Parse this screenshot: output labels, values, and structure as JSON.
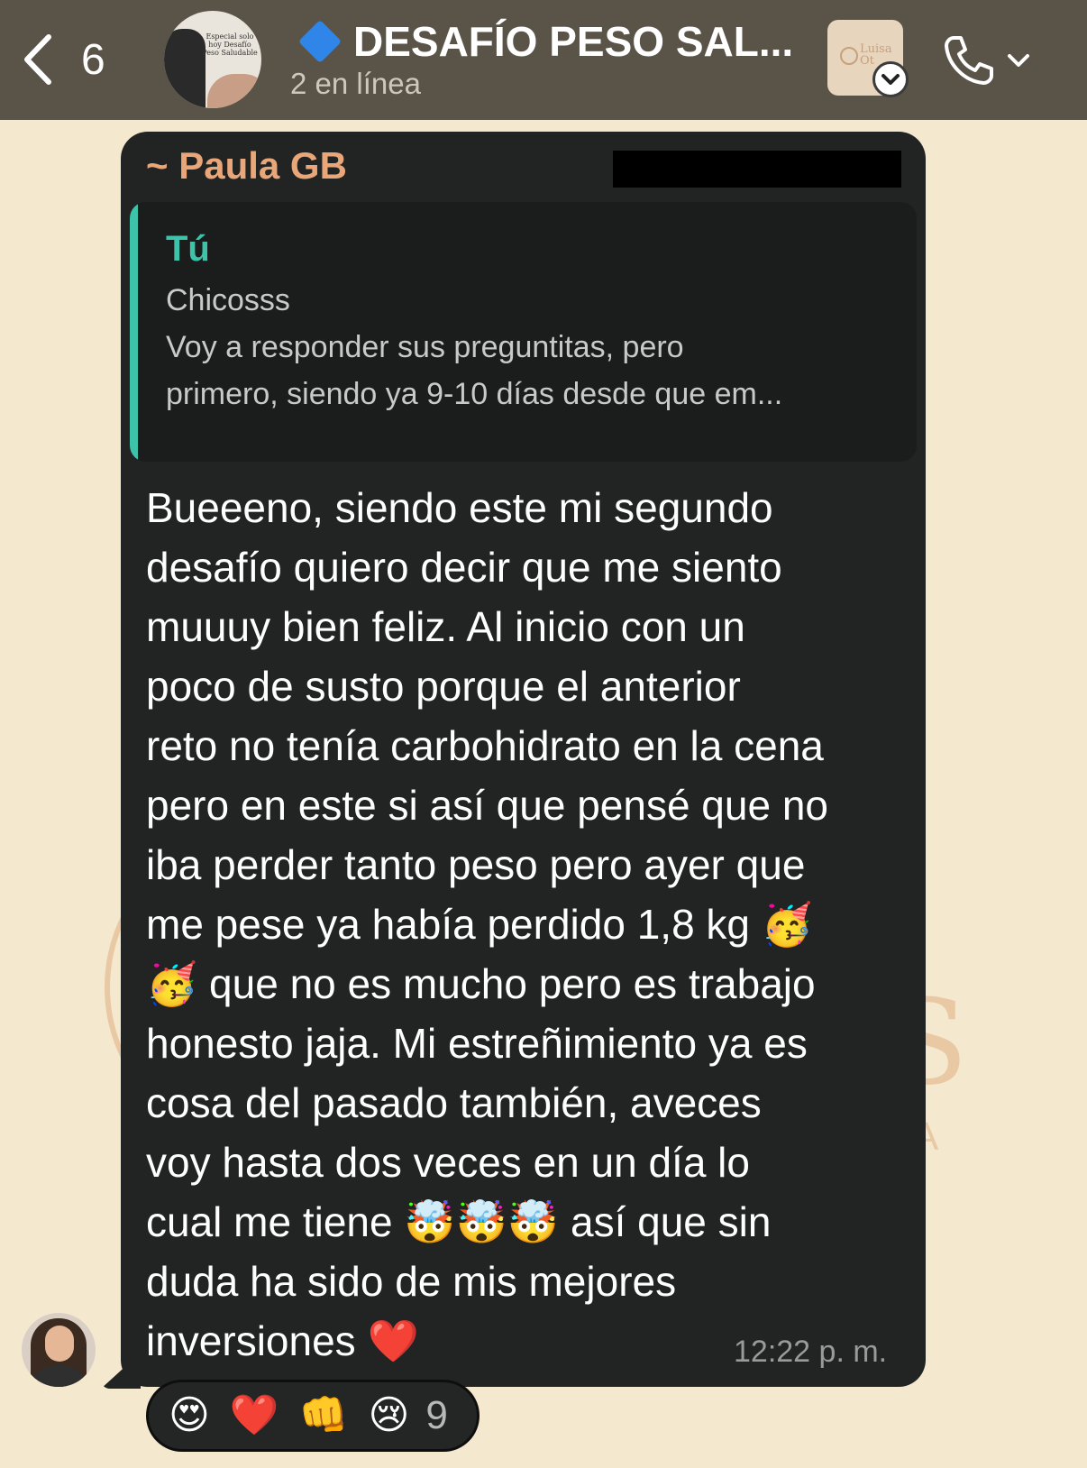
{
  "header": {
    "back_count": "6",
    "title": "DESAFÍO PESO SAL...",
    "subtitle": "2 en línea",
    "avatar_lettering": "Especial solo hoy Desafío Peso Saludable",
    "thumb_lettering": "Luisa Ot"
  },
  "message": {
    "sender": "~ Paula GB",
    "quote": {
      "author": "Tú",
      "lines": [
        "Chicosss",
        "Voy a responder sus preguntitas, pero",
        "primero, siendo ya 9-10 días desde que em..."
      ]
    },
    "lines": [
      "Bueeeno, siendo este mi segundo",
      "desafío quiero decir que me siento",
      "muuuy bien feliz. Al inicio con un",
      "poco de susto porque el anterior",
      "reto no tenía carbohidrato en la cena",
      "pero en este si así que pensé que no",
      "iba perder tanto peso pero ayer que",
      "me pese ya había perdido 1,8 kg 🥳",
      "🥳 que no es mucho pero es trabajo",
      "honesto jaja. Mi estreñimiento ya es",
      "cosa del pasado también, aveces",
      "voy hasta dos veces en un día lo",
      "cual me tiene 🤯🤯🤯 así que sin",
      "duda ha sido de mis mejores",
      "inversiones ❤️"
    ],
    "time": "12:22 p. m."
  },
  "reactions": {
    "emojis": [
      "😍",
      "❤️",
      "👊",
      "😢"
    ],
    "count": "9"
  },
  "colors": {
    "header_bg": "#595348",
    "chat_bg": "#f4e8cf",
    "bubble_bg": "#222424",
    "sender_name": "#e9a679",
    "quote_accent": "#3cc3a9"
  },
  "icons": [
    "back-chevron-icon",
    "diamond-icon",
    "chevron-down-icon",
    "phone-icon"
  ]
}
